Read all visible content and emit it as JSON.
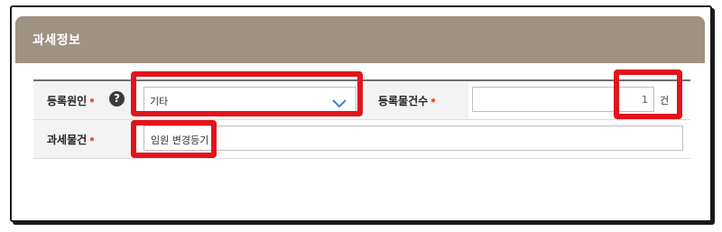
{
  "panel": {
    "title": "과세정보"
  },
  "form": {
    "cause": {
      "label": "등록원인",
      "required_mark": "•",
      "help_glyph": "?",
      "selected": "기타"
    },
    "count": {
      "label": "등록물건수",
      "required_mark": "•",
      "value": "1",
      "unit": "건"
    },
    "object": {
      "label": "과세물건",
      "required_mark": "•",
      "value": "임원 변경등기"
    }
  },
  "colors": {
    "header": "#9e9381",
    "highlight": "#e3141d",
    "required": "#e06020",
    "chevron": "#3f7fc0"
  }
}
